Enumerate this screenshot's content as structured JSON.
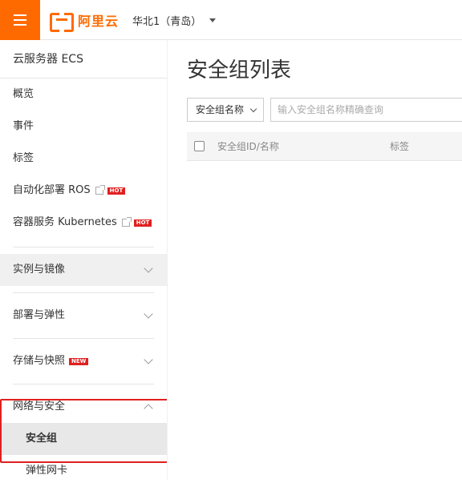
{
  "header": {
    "logo_text": "阿里云",
    "region": "华北1（青岛）"
  },
  "sidebar": {
    "title": "云服务器 ECS",
    "items": [
      {
        "label": "概览"
      },
      {
        "label": "事件"
      },
      {
        "label": "标签"
      },
      {
        "label": "自动化部署 ROS",
        "badge": "HOT"
      },
      {
        "label": "容器服务 Kubernetes",
        "badge": "HOT"
      }
    ],
    "sections": [
      {
        "label": "实例与镜像"
      },
      {
        "label": "部署与弹性"
      },
      {
        "label": "存储与快照",
        "badge": "NEW"
      },
      {
        "label": "网络与安全"
      }
    ],
    "sub_items": [
      {
        "label": "安全组"
      },
      {
        "label": "弹性网卡"
      }
    ]
  },
  "main": {
    "title": "安全组列表",
    "filter": {
      "selected": "安全组名称",
      "placeholder": "输入安全组名称精确查询"
    },
    "table": {
      "columns": [
        "安全组ID/名称",
        "标签"
      ]
    }
  },
  "colors": {
    "brand": "#ff6a00",
    "highlight": "#e02020",
    "badge": "#e02020"
  }
}
